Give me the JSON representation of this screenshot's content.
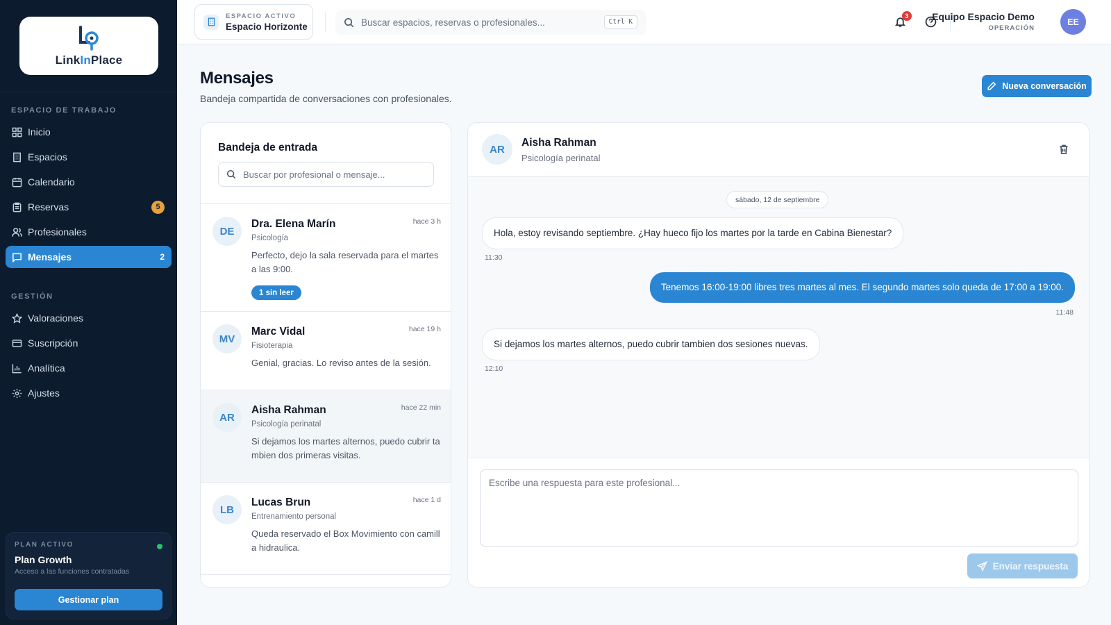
{
  "brand": {
    "name_part1": "Link",
    "name_part2": "In",
    "name_part3": "Place"
  },
  "sidebar": {
    "section_workspace": "ESPACIO DE TRABAJO",
    "section_management": "GESTIÓN",
    "items": [
      {
        "label": "Inicio",
        "icon": "grid-icon"
      },
      {
        "label": "Espacios",
        "icon": "building-icon"
      },
      {
        "label": "Calendario",
        "icon": "calendar-icon"
      },
      {
        "label": "Reservas",
        "icon": "clipboard-icon",
        "badge": "5"
      },
      {
        "label": "Profesionales",
        "icon": "users-icon"
      },
      {
        "label": "Mensajes",
        "icon": "message-icon",
        "badge": "2",
        "active": true
      },
      {
        "label": "Valoraciones",
        "icon": "star-icon"
      },
      {
        "label": "Suscripción",
        "icon": "credit-card-icon"
      },
      {
        "label": "Analítica",
        "icon": "bar-chart-icon"
      },
      {
        "label": "Ajustes",
        "icon": "gear-icon"
      }
    ],
    "plan": {
      "label": "PLAN ACTIVO",
      "name": "Plan Growth",
      "desc": "Acceso a las funciones contratadas",
      "button": "Gestionar plan"
    }
  },
  "topbar": {
    "space_kicker": "ESPACIO ACTIVO",
    "space_name": "Espacio Horizonte",
    "search_placeholder": "Buscar espacios, reservas o profesionales...",
    "shortcut": "Ctrl K",
    "notifications_count": "3",
    "user_name": "Equipo Espacio Demo",
    "user_role": "OPERACIÓN",
    "user_initials": "EE"
  },
  "page": {
    "title": "Mensajes",
    "subtitle": "Bandeja compartida de conversaciones con profesionales.",
    "new_button": "Nueva conversación"
  },
  "inbox": {
    "title": "Bandeja de entrada",
    "search_placeholder": "Buscar por profesional o mensaje...",
    "conversations": [
      {
        "initials": "DE",
        "name": "Dra. Elena Marín",
        "spec": "Psicología",
        "time": "hace 3 h",
        "preview": "Perfecto, dejo la sala reservada para el martes a las 9:00.",
        "unread": "1 sin leer"
      },
      {
        "initials": "MV",
        "name": "Marc Vidal",
        "spec": "Fisioterapia",
        "time": "hace 19 h",
        "preview": "Genial, gracias. Lo reviso antes de la sesión."
      },
      {
        "initials": "AR",
        "name": "Aisha Rahman",
        "spec": "Psicología perinatal",
        "time": "hace 22 min",
        "preview": "Si dejamos los martes alternos, puedo cubrir tambien dos primeras visitas."
      },
      {
        "initials": "LB",
        "name": "Lucas Brun",
        "spec": "Entrenamiento personal",
        "time": "hace 1 d",
        "preview": "Queda reservado el Box Movimiento con camilla hidraulica."
      }
    ]
  },
  "chat": {
    "initials": "AR",
    "name": "Aisha Rahman",
    "spec": "Psicología perinatal",
    "date": "sábado, 12 de septiembre",
    "messages": [
      {
        "text": "Hola, estoy revisando septiembre. ¿Hay hueco fijo los martes por la tarde en Cabina Bienestar?",
        "time": "11:30",
        "dir": "in"
      },
      {
        "text": "Tenemos 16:00-19:00 libres tres martes al mes. El segundo martes solo queda de 17:00 a 19:00.",
        "time": "11:48",
        "dir": "out"
      },
      {
        "text": "Si dejamos los martes alternos, puedo cubrir tambien dos sesiones nuevas.",
        "time": "12:10",
        "dir": "in"
      }
    ],
    "reply_placeholder": "Escribe una respuesta para este profesional...",
    "send_button": "Enviar respuesta"
  }
}
